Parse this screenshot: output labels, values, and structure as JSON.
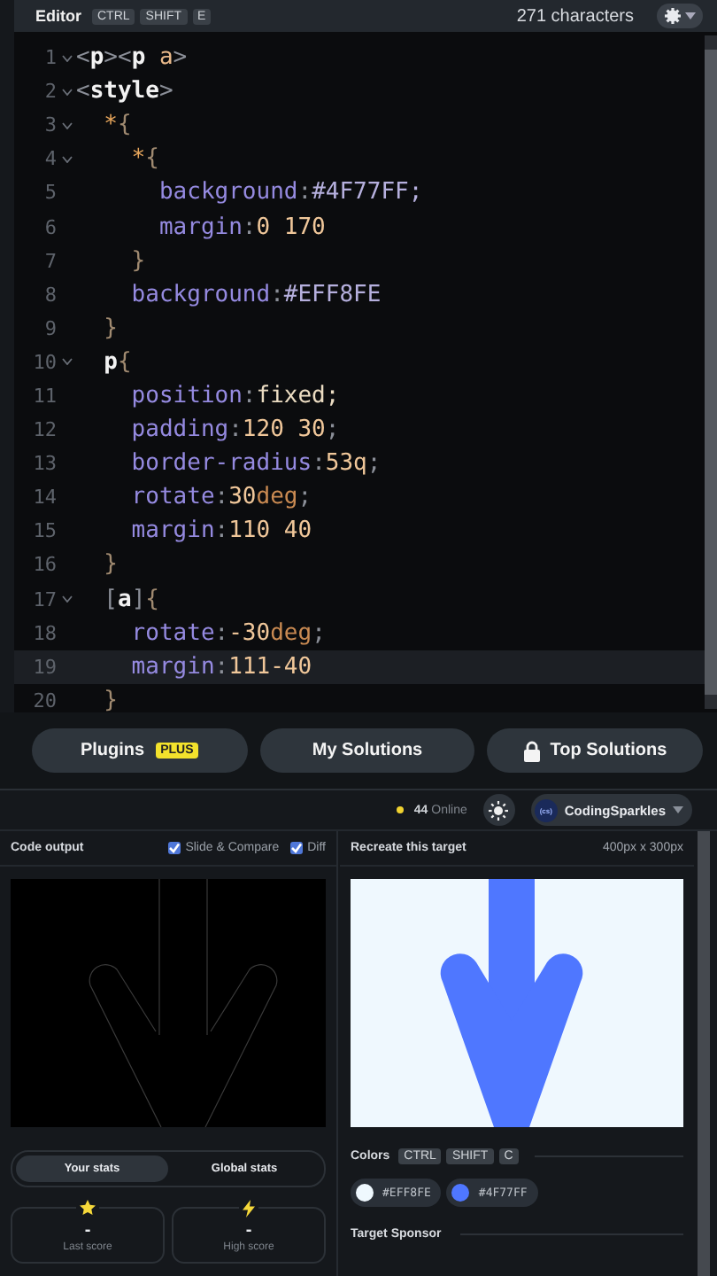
{
  "editor": {
    "title": "Editor",
    "shortcut": [
      "CTRL",
      "SHIFT",
      "E"
    ],
    "char_count": "271 characters",
    "lines": [
      {
        "number": "1",
        "foldable": true,
        "highlighted": false,
        "tokens": [
          {
            "kind": "punct",
            "text": "<"
          },
          {
            "kind": "tag",
            "text": "p"
          },
          {
            "kind": "punct",
            "text": "><"
          },
          {
            "kind": "tag",
            "text": "p "
          },
          {
            "kind": "attr",
            "text": "a"
          },
          {
            "kind": "punct",
            "text": ">"
          }
        ]
      },
      {
        "number": "2",
        "foldable": true,
        "highlighted": false,
        "tokens": [
          {
            "kind": "punct",
            "text": "<"
          },
          {
            "kind": "tag",
            "text": "style"
          },
          {
            "kind": "punct",
            "text": ">"
          }
        ]
      },
      {
        "number": "3",
        "foldable": true,
        "highlighted": false,
        "tokens": [
          {
            "kind": "selector",
            "text": "  *"
          },
          {
            "kind": "brace",
            "text": "{"
          }
        ]
      },
      {
        "number": "4",
        "foldable": true,
        "highlighted": false,
        "tokens": [
          {
            "kind": "selector",
            "text": "    *"
          },
          {
            "kind": "brace",
            "text": "{"
          }
        ]
      },
      {
        "number": "5",
        "foldable": false,
        "highlighted": false,
        "tokens": [
          {
            "kind": "prop",
            "text": "      background"
          },
          {
            "kind": "punct",
            "text": ":"
          },
          {
            "kind": "hex",
            "text": "#4F77FF;"
          }
        ]
      },
      {
        "number": "6",
        "foldable": false,
        "highlighted": false,
        "tokens": [
          {
            "kind": "prop",
            "text": "      margin"
          },
          {
            "kind": "punct",
            "text": ":"
          },
          {
            "kind": "number",
            "text": "0 170"
          }
        ]
      },
      {
        "number": "7",
        "foldable": false,
        "highlighted": false,
        "tokens": [
          {
            "kind": "brace",
            "text": "    }"
          }
        ]
      },
      {
        "number": "8",
        "foldable": false,
        "highlighted": false,
        "tokens": [
          {
            "kind": "prop",
            "text": "    background"
          },
          {
            "kind": "punct",
            "text": ":"
          },
          {
            "kind": "hex",
            "text": "#EFF8FE"
          }
        ]
      },
      {
        "number": "9",
        "foldable": false,
        "highlighted": false,
        "tokens": [
          {
            "kind": "brace",
            "text": "  }"
          }
        ]
      },
      {
        "number": "10",
        "foldable": true,
        "highlighted": false,
        "tokens": [
          {
            "kind": "tag",
            "text": "  p"
          },
          {
            "kind": "brace",
            "text": "{"
          }
        ]
      },
      {
        "number": "11",
        "foldable": false,
        "highlighted": false,
        "tokens": [
          {
            "kind": "prop",
            "text": "    position"
          },
          {
            "kind": "punct",
            "text": ":"
          },
          {
            "kind": "keyword",
            "text": "fixed;"
          }
        ]
      },
      {
        "number": "12",
        "foldable": false,
        "highlighted": false,
        "tokens": [
          {
            "kind": "prop",
            "text": "    padding"
          },
          {
            "kind": "punct",
            "text": ":"
          },
          {
            "kind": "number",
            "text": "120 30"
          },
          {
            "kind": "punct",
            "text": ";"
          }
        ]
      },
      {
        "number": "13",
        "foldable": false,
        "highlighted": false,
        "tokens": [
          {
            "kind": "prop",
            "text": "    border-radius"
          },
          {
            "kind": "punct",
            "text": ":"
          },
          {
            "kind": "number",
            "text": "53q"
          },
          {
            "kind": "punct",
            "text": ";"
          }
        ]
      },
      {
        "number": "14",
        "foldable": false,
        "highlighted": false,
        "tokens": [
          {
            "kind": "prop",
            "text": "    rotate"
          },
          {
            "kind": "punct",
            "text": ":"
          },
          {
            "kind": "number",
            "text": "30"
          },
          {
            "kind": "unit",
            "text": "deg"
          },
          {
            "kind": "punct",
            "text": ";"
          }
        ]
      },
      {
        "number": "15",
        "foldable": false,
        "highlighted": false,
        "tokens": [
          {
            "kind": "prop",
            "text": "    margin"
          },
          {
            "kind": "punct",
            "text": ":"
          },
          {
            "kind": "number",
            "text": "110 40"
          }
        ]
      },
      {
        "number": "16",
        "foldable": false,
        "highlighted": false,
        "tokens": [
          {
            "kind": "brace",
            "text": "  }"
          }
        ]
      },
      {
        "number": "17",
        "foldable": true,
        "highlighted": false,
        "tokens": [
          {
            "kind": "punct",
            "text": "  ["
          },
          {
            "kind": "tag",
            "text": "a"
          },
          {
            "kind": "punct",
            "text": "]"
          },
          {
            "kind": "brace",
            "text": "{"
          }
        ]
      },
      {
        "number": "18",
        "foldable": false,
        "highlighted": false,
        "tokens": [
          {
            "kind": "prop",
            "text": "    rotate"
          },
          {
            "kind": "punct",
            "text": ":"
          },
          {
            "kind": "number",
            "text": "-30"
          },
          {
            "kind": "unit",
            "text": "deg"
          },
          {
            "kind": "punct",
            "text": ";"
          }
        ]
      },
      {
        "number": "19",
        "foldable": false,
        "highlighted": true,
        "tokens": [
          {
            "kind": "prop",
            "text": "    margin"
          },
          {
            "kind": "punct",
            "text": ":"
          },
          {
            "kind": "number",
            "text": "111-40"
          }
        ]
      },
      {
        "number": "20",
        "foldable": false,
        "highlighted": false,
        "tokens": [
          {
            "kind": "brace",
            "text": "  }"
          }
        ]
      }
    ]
  },
  "actions": [
    {
      "label": "Plugins",
      "badge": "PLUS",
      "locked": false
    },
    {
      "label": "My Solutions",
      "locked": false
    },
    {
      "label": "Top Solutions",
      "locked": true
    }
  ],
  "status": {
    "online": "44",
    "online_label": "Online",
    "user": {
      "avatar": "(cs)",
      "name": "CodingSparkles"
    }
  },
  "output": {
    "title": "Code output",
    "options": [
      {
        "label": "Slide & Compare",
        "checked": true
      },
      {
        "label": "Diff",
        "checked": true
      }
    ]
  },
  "stats": {
    "tabs": [
      {
        "label": "Your stats",
        "selected": true
      },
      {
        "label": "Global stats",
        "selected": false
      }
    ],
    "cards": [
      {
        "kind": "star",
        "value": "-",
        "label": "Last score"
      },
      {
        "kind": "bolt",
        "value": "-",
        "label": "High score"
      }
    ]
  },
  "target": {
    "title": "Recreate this target",
    "size": "400px x 300px",
    "colors_label": "Colors",
    "shortcut": [
      "CTRL",
      "SHIFT",
      "C"
    ],
    "colors": [
      {
        "label": "#EFF8FE",
        "color": "#eff8fe"
      },
      {
        "label": "#4F77FF",
        "color": "#4f77ff"
      }
    ],
    "sponsor_label": "Target Sponsor"
  }
}
